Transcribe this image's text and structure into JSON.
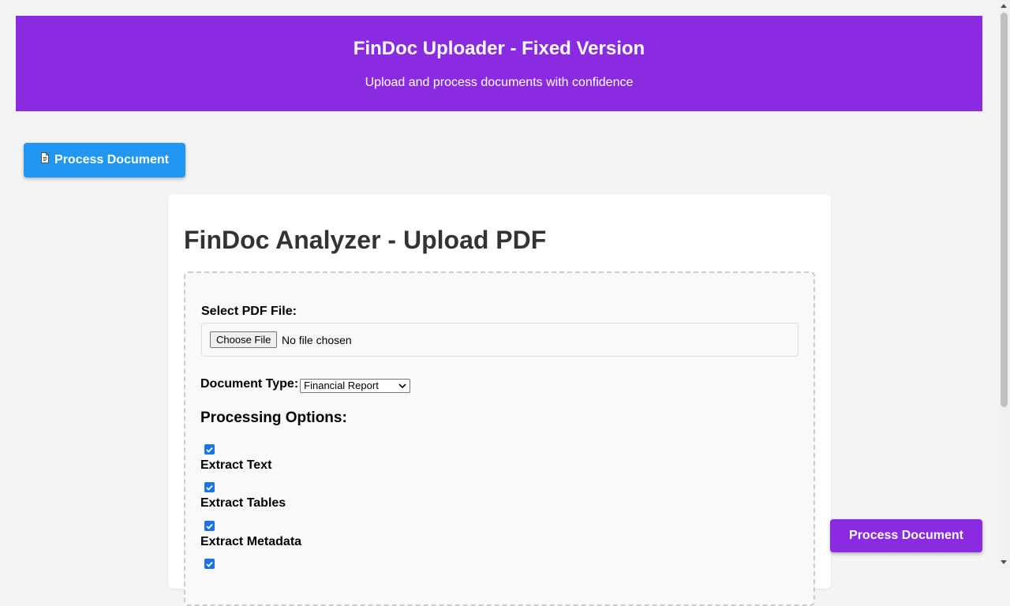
{
  "header": {
    "title": "FinDoc Uploader - Fixed Version",
    "subtitle": "Upload and process documents with confidence"
  },
  "top_button": {
    "icon": "document-icon",
    "label": "Process Document"
  },
  "card": {
    "title": "FinDoc Analyzer - Upload PDF"
  },
  "upload": {
    "file_label": "Select PDF File:",
    "choose_button": "Choose File",
    "file_status": "No file chosen",
    "doc_type_label": "Document Type:",
    "doc_type_selected": "Financial Report",
    "processing_heading": "Processing Options:",
    "options": [
      {
        "label": "Extract Text",
        "checked": true
      },
      {
        "label": "Extract Tables",
        "checked": true
      },
      {
        "label": "Extract Metadata",
        "checked": true
      },
      {
        "label": "",
        "checked": true
      }
    ]
  },
  "floating_button": {
    "label": "Process Document"
  },
  "colors": {
    "header_bg": "#8a2be2",
    "top_button_bg": "#2196f3",
    "floating_button_bg": "#8a2be2",
    "checkbox": "#1a73e8"
  }
}
